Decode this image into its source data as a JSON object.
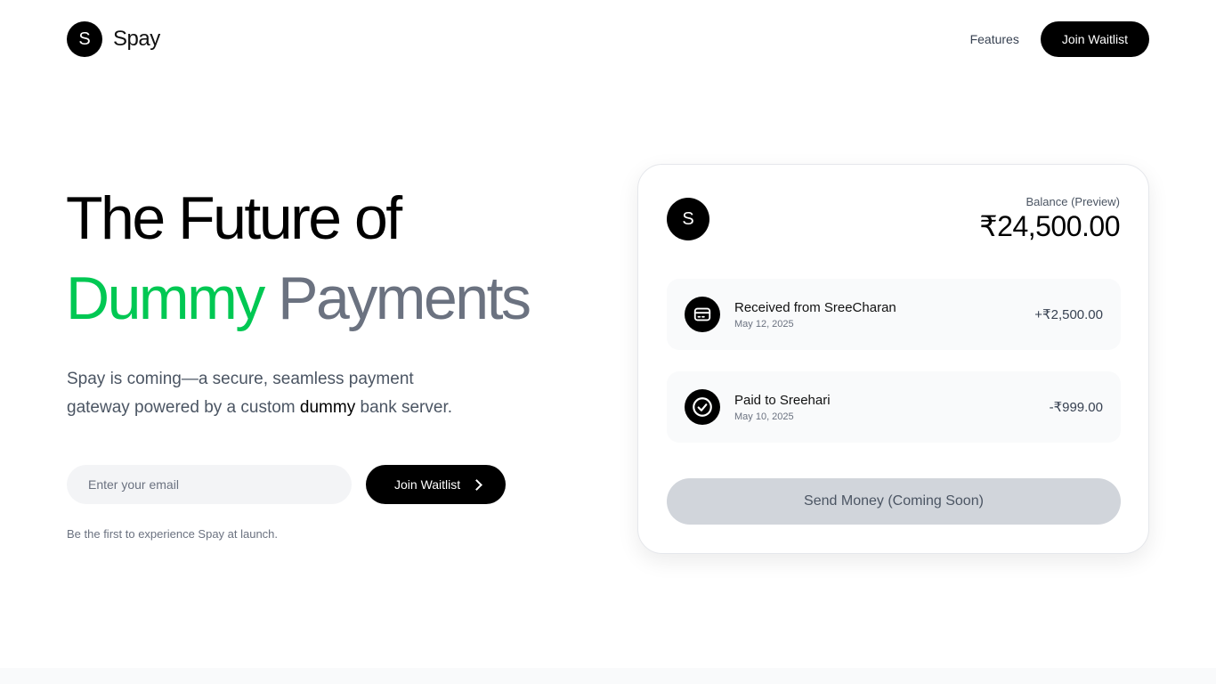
{
  "nav": {
    "brand_initial": "S",
    "brand_name": "Spay",
    "links": [
      "Features"
    ],
    "cta": "Join Waitlist"
  },
  "hero": {
    "title_line1": "The Future of",
    "title_accent": "Dummy",
    "title_muted": "Payments",
    "subtitle_pre": "Spay is coming—a secure, seamless payment gateway powered by a custom ",
    "subtitle_em": "dummy",
    "subtitle_post": " bank server.",
    "email_placeholder": "Enter your email",
    "cta": "Join Waitlist",
    "hint": "Be the first to experience Spay at launch."
  },
  "card": {
    "avatar_initial": "S",
    "balance_label": "Balance (Preview)",
    "balance_value": "₹24,500.00",
    "transactions": [
      {
        "title": "Received from SreeCharan",
        "date": "May 12, 2025",
        "amount": "+₹2,500.00",
        "icon": "card-icon"
      },
      {
        "title": "Paid to Sreehari",
        "date": "May 10, 2025",
        "amount": "-₹999.00",
        "icon": "check-circle-icon"
      }
    ],
    "send_button": "Send Money (Coming Soon)"
  },
  "colors": {
    "accent": "#00c853",
    "muted": "#6b7280",
    "dark": "#000000",
    "disabled": "#d1d5db"
  }
}
